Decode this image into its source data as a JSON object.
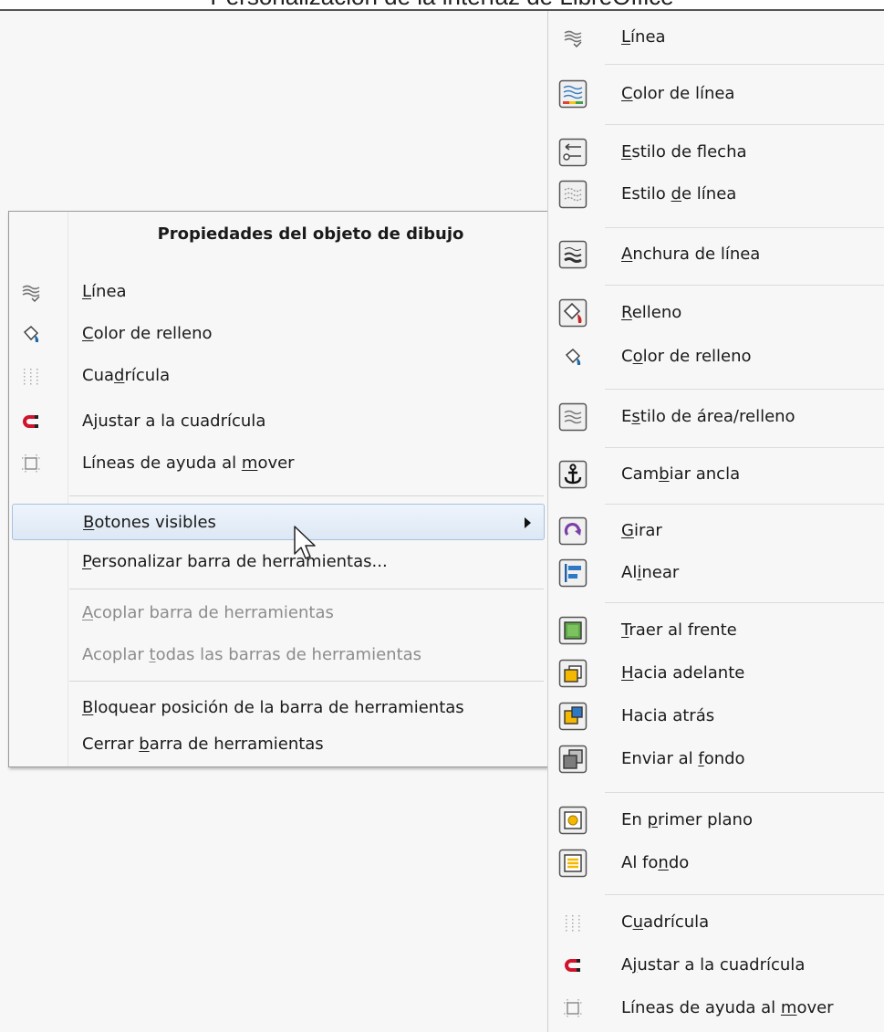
{
  "page_title": "Personalización de la interfaz de LibreOffice",
  "context_menu": {
    "header": "Propiedades del objeto de dibujo",
    "items": [
      {
        "pre": "",
        "acc": "L",
        "post": "ínea",
        "icon": "line-icon"
      },
      {
        "pre": "",
        "acc": "C",
        "post": "olor de relleno",
        "icon": "fill-color-icon"
      },
      {
        "pre": "Cua",
        "acc": "d",
        "post": "rícula",
        "icon": "grid-icon"
      },
      {
        "pre": "A",
        "acc": "j",
        "post": "ustar a la cuadrícula",
        "icon": "snap-to-grid-icon"
      },
      {
        "pre": "Líneas de ayuda al ",
        "acc": "m",
        "post": "over",
        "icon": "helplines-icon"
      },
      {
        "pre": "",
        "acc": "B",
        "post": "otones visibles",
        "highlighted": true,
        "submenu": true
      },
      {
        "pre": "",
        "acc": "P",
        "post": "ersonalizar barra de herramientas..."
      },
      {
        "pre": "",
        "acc": "A",
        "post": "coplar barra de herramientas",
        "disabled": true
      },
      {
        "pre": "Acoplar ",
        "acc": "t",
        "post": "odas las barras de herramientas",
        "disabled": true
      },
      {
        "pre": "",
        "acc": "B",
        "post": "loquear posición de la barra de herramientas"
      },
      {
        "pre": "Cerrar ",
        "acc": "b",
        "post": "arra de herramientas"
      }
    ]
  },
  "buttons_panel": {
    "items": [
      {
        "pre": "",
        "acc": "L",
        "post": "ínea",
        "icon": "line-icon"
      },
      {
        "pre": "",
        "acc": "C",
        "post": "olor de línea",
        "icon": "line-color-icon"
      },
      {
        "pre": "",
        "acc": "E",
        "post": "stilo de flecha",
        "icon": "arrow-style-icon"
      },
      {
        "pre": "Estilo ",
        "acc": "d",
        "post": "e línea",
        "icon": "line-style-icon"
      },
      {
        "pre": "",
        "acc": "A",
        "post": "nchura de línea",
        "icon": "line-width-icon"
      },
      {
        "pre": "",
        "acc": "R",
        "post": "elleno",
        "icon": "fill-icon"
      },
      {
        "pre": "C",
        "acc": "o",
        "post": "lor de relleno",
        "icon": "fill-color-icon"
      },
      {
        "pre": "E",
        "acc": "s",
        "post": "tilo de área/relleno",
        "icon": "area-style-icon"
      },
      {
        "pre": "Cam",
        "acc": "b",
        "post": "iar ancla",
        "icon": "anchor-icon"
      },
      {
        "pre": "",
        "acc": "G",
        "post": "irar",
        "icon": "rotate-icon"
      },
      {
        "pre": "Al",
        "acc": "i",
        "post": "near",
        "icon": "align-icon"
      },
      {
        "pre": "",
        "acc": "T",
        "post": "raer al frente",
        "icon": "bring-to-front-icon"
      },
      {
        "pre": "",
        "acc": "H",
        "post": "acia adelante",
        "icon": "bring-forward-icon"
      },
      {
        "pre": "Hacia atrás",
        "acc": "",
        "post": "",
        "icon": "send-backward-icon"
      },
      {
        "pre": "Enviar al ",
        "acc": "f",
        "post": "ondo",
        "icon": "send-to-back-icon"
      },
      {
        "pre": "En ",
        "acc": "p",
        "post": "rimer plano",
        "icon": "foreground-icon"
      },
      {
        "pre": "Al fo",
        "acc": "n",
        "post": "do",
        "icon": "background-icon"
      },
      {
        "pre": "C",
        "acc": "u",
        "post": "adrícula",
        "icon": "grid-icon"
      },
      {
        "pre": "A",
        "acc": "j",
        "post": "ustar a la cuadrícula",
        "icon": "snap-to-grid-icon"
      },
      {
        "pre": "Líneas de ayuda al ",
        "acc": "m",
        "post": "over",
        "icon": "helplines-icon"
      }
    ]
  }
}
